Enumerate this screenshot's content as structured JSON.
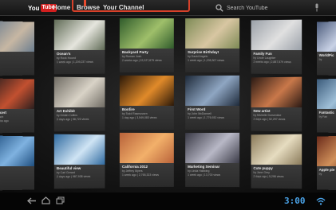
{
  "app": {
    "logo_you": "You",
    "logo_tube": "Tube",
    "tabs": [
      {
        "label": "Home"
      },
      {
        "label": "Browse"
      },
      {
        "label": "Your Channel"
      }
    ],
    "search_placeholder": "Search YouTube",
    "highlight_color": "#d7412a"
  },
  "videos": [
    {
      "title": "",
      "by": "",
      "stats": "",
      "colors": [
        "#6b7d8f",
        "#c7b7a3"
      ]
    },
    {
      "title": "Ocean's",
      "by": "by Rock Hound",
      "stats": "1 week ago | 1,209,237 views",
      "colors": [
        "#5f6a55",
        "#e5e5dd"
      ]
    },
    {
      "title": "Backyard Party",
      "by": "by Roman Josh",
      "stats": "2 weeks ago | 22,227,875 views",
      "colors": [
        "#2f5b2b",
        "#9fbf6a"
      ]
    },
    {
      "title": "Surprise Birthday!",
      "by": "by David Angelo",
      "stats": "1 week ago | 1,235,307 views",
      "colors": [
        "#7d8a55",
        "#d8c6a2"
      ]
    },
    {
      "title": "Family Fun",
      "by": "by Uncle Laughter",
      "stats": "2 weeks ago | 2,887,579 views",
      "colors": [
        "#9aa0a8",
        "#e0e0e0"
      ]
    },
    {
      "title": "WorldPic",
      "by": "by",
      "stats": "",
      "colors": [
        "#4a5a7a",
        "#c9d2e6"
      ]
    },
    {
      "title": "Concert",
      "by": "by Finch",
      "stats": "3 weeks ago",
      "colors": [
        "#2a1e1e",
        "#c25030"
      ]
    },
    {
      "title": "Art Exhibit",
      "by": "by Kristin Collins",
      "stats": "3 days ago | 58,720 views",
      "colors": [
        "#6f6b63",
        "#d9d3c7"
      ]
    },
    {
      "title": "Bonfire",
      "by": "by Todd Rasmussen",
      "stats": "1 day ago | 3,549,083 views",
      "colors": [
        "#2a1808",
        "#e08a2a"
      ]
    },
    {
      "title": "First Word",
      "by": "by John McDonnell",
      "stats": "1 week ago | 1,776,932 views",
      "colors": [
        "#1e2a3a",
        "#8fa6c2"
      ]
    },
    {
      "title": "New artist",
      "by": "by Michelle Dorsentine",
      "stats": "2 days ago | 52,297 views",
      "colors": [
        "#2a1a14",
        "#c9784a"
      ]
    },
    {
      "title": "Fantastic",
      "by": "by Fan",
      "stats": "",
      "colors": [
        "#3a5a7a",
        "#a0c0d8"
      ]
    },
    {
      "title": "",
      "by": "",
      "stats": "",
      "colors": [
        "#1f4f80",
        "#7fb2e0"
      ]
    },
    {
      "title": "Beautiful view",
      "by": "by Carl Gerard",
      "stats": "2 days ago | 987,938 views",
      "colors": [
        "#2f6aa0",
        "#cfe4f4"
      ]
    },
    {
      "title": "California 2012",
      "by": "by Jeffrey Myers",
      "stats": "1 week ago | 2,765,323 views",
      "colors": [
        "#b8623a",
        "#f2b06a"
      ]
    },
    {
      "title": "Marketing Seminar",
      "by": "by Linda Hallwing",
      "stats": "1 week ago | 13,700 views",
      "colors": [
        "#3a3a46",
        "#b8b8c6"
      ]
    },
    {
      "title": "Cute puppy",
      "by": "by Jane Grey",
      "stats": "2 days ago | 5,298 views",
      "colors": [
        "#8a7a5a",
        "#e6dcc0"
      ]
    },
    {
      "title": "Apple pie",
      "by": "by",
      "stats": "",
      "colors": [
        "#6a2a1a",
        "#d0905a"
      ]
    }
  ],
  "system_bar": {
    "clock": "3:00"
  }
}
